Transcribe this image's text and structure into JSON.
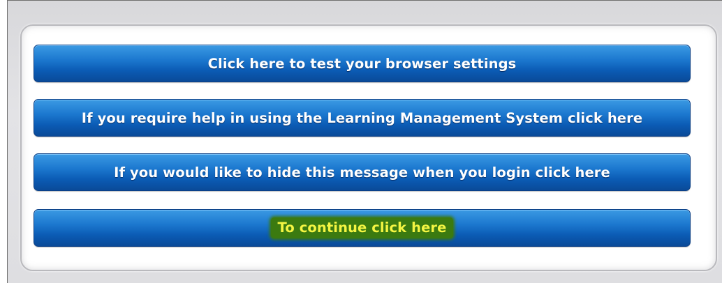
{
  "buttons": {
    "test_browser": "Click here to test your browser settings",
    "help": "If you require help in using the Learning Management System click here",
    "hide_message": "If you would like to hide this message when you login click here",
    "continue": "To continue click here"
  },
  "colors": {
    "button_blue": "#0b5bb4",
    "highlight_background": "#3b7a10",
    "highlight_text": "#f4f542"
  }
}
